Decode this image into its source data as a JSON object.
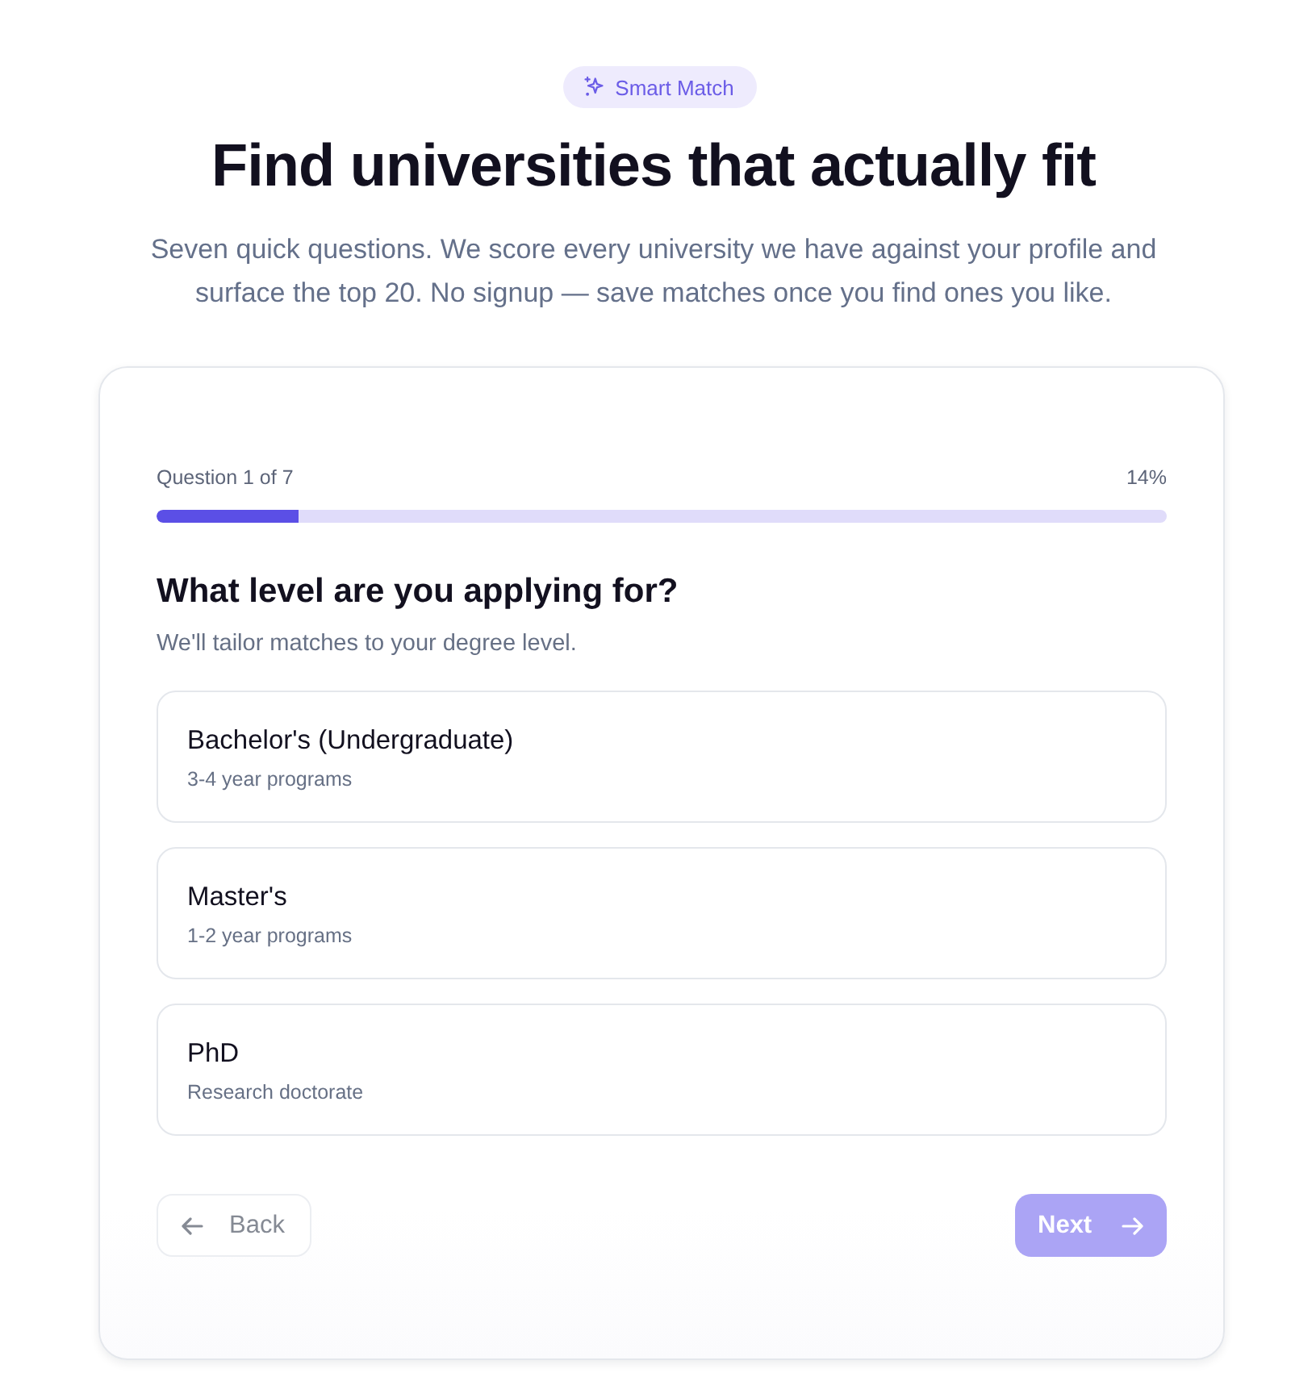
{
  "badge": {
    "label": "Smart Match"
  },
  "heading": "Find universities that actually fit",
  "intro": "Seven quick questions. We score every university we have against your profile and surface the top 20. No signup — save matches once you find ones you like.",
  "progress": {
    "label": "Question 1 of 7",
    "percent": "14%",
    "level": 0.14
  },
  "question": {
    "title": "What level are you applying for?",
    "hint": "We'll tailor matches to your degree level."
  },
  "options": [
    {
      "title": "Bachelor's (Undergraduate)",
      "detail": "3-4 year programs",
      "selected": false
    },
    {
      "title": "Master's",
      "detail": "1-2 year programs",
      "selected": false
    },
    {
      "title": "PhD",
      "detail": "Research doctorate",
      "selected": false
    }
  ],
  "buttons": [
    {
      "kind": "back",
      "label": "Back",
      "disabled": true
    },
    {
      "kind": "next",
      "label": "Next",
      "disabled": true
    }
  ]
}
